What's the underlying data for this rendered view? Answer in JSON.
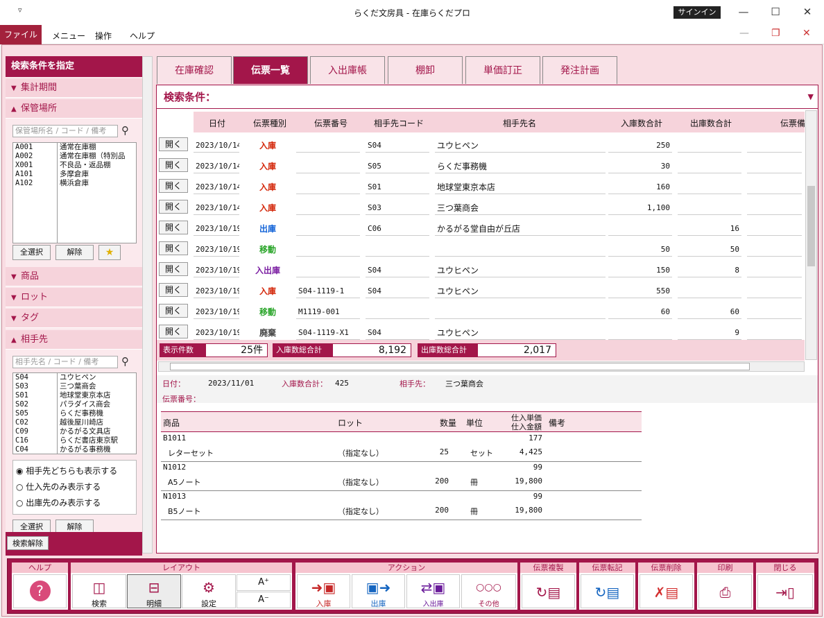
{
  "window": {
    "quick_access": "▿",
    "title": "らくだ文房具 - 在庫らくだプロ",
    "signin": "サインイン",
    "min": "—",
    "max": "☐",
    "close": "✕",
    "restore": "❐"
  },
  "menu": {
    "file": "ファイル",
    "menu": "メニュー",
    "ops": "操作",
    "help": "ヘルプ"
  },
  "left": {
    "header": "検索条件を指定",
    "sections": {
      "period": "集計期間",
      "location": "保管場所",
      "product": "商品",
      "lot": "ロット",
      "tag": "タグ",
      "partner": "相手先"
    },
    "loc_search_placeholder": "保管場所名 / コード / 備考",
    "locations": [
      {
        "code": "A001",
        "name": "通常在庫棚"
      },
      {
        "code": "A002",
        "name": "通常在庫棚（特別品"
      },
      {
        "code": "X001",
        "name": "不良品・返品棚"
      },
      {
        "code": "A101",
        "name": "多摩倉庫"
      },
      {
        "code": "A102",
        "name": "横浜倉庫"
      }
    ],
    "select_all": "全選択",
    "clear": "解除",
    "star": "★",
    "partner_search_placeholder": "相手先名 / コード / 備考",
    "partners": [
      {
        "code": "S04",
        "name": "ユウヒペン"
      },
      {
        "code": "S03",
        "name": "三つ葉商会"
      },
      {
        "code": "S01",
        "name": "地球堂東京本店"
      },
      {
        "code": "S02",
        "name": "パラダイス商会"
      },
      {
        "code": "S05",
        "name": "らくだ事務機"
      },
      {
        "code": "C02",
        "name": "越後屋川崎店"
      },
      {
        "code": "C09",
        "name": "かるがる文具店"
      },
      {
        "code": "C16",
        "name": "らくだ書店東京駅"
      },
      {
        "code": "C04",
        "name": "かるがる事務機"
      }
    ],
    "radio": [
      "相手先どちらも表示する",
      "仕入先のみ表示する",
      "出庫先のみ表示する"
    ],
    "select_all2": "全選択",
    "clear2": "解除",
    "search_clear": "検索解除"
  },
  "tabs": [
    "在庫確認",
    "伝票一覧",
    "入出庫帳",
    "棚卸",
    "単価訂正",
    "発注計画"
  ],
  "search_cond": "検索条件：",
  "grid": {
    "headers": {
      "date": "日付",
      "type": "伝票種別",
      "no": "伝票番号",
      "code": "相手先コード",
      "name": "相手先名",
      "in": "入庫数合計",
      "out": "出庫数合計",
      "note": "伝票備"
    },
    "open": "開く",
    "rows": [
      {
        "date": "2023/10/14",
        "type": "入庫",
        "no": "",
        "code": "S04",
        "name": "ユウヒペン",
        "in": "250",
        "out": ""
      },
      {
        "date": "2023/10/14",
        "type": "入庫",
        "no": "",
        "code": "S05",
        "name": "らくだ事務機",
        "in": "30",
        "out": ""
      },
      {
        "date": "2023/10/14",
        "type": "入庫",
        "no": "",
        "code": "S01",
        "name": "地球堂東京本店",
        "in": "160",
        "out": ""
      },
      {
        "date": "2023/10/14",
        "type": "入庫",
        "no": "",
        "code": "S03",
        "name": "三つ葉商会",
        "in": "1,100",
        "out": ""
      },
      {
        "date": "2023/10/19",
        "type": "出庫",
        "no": "",
        "code": "C06",
        "name": "かるがる堂自由が丘店",
        "in": "",
        "out": "16"
      },
      {
        "date": "2023/10/19",
        "type": "移動",
        "no": "",
        "code": "",
        "name": "",
        "in": "50",
        "out": "50"
      },
      {
        "date": "2023/10/19",
        "type": "入出庫",
        "no": "",
        "code": "S04",
        "name": "ユウヒペン",
        "in": "150",
        "out": "8"
      },
      {
        "date": "2023/10/19",
        "type": "入庫",
        "no": "S04-1119-1",
        "code": "S04",
        "name": "ユウヒペン",
        "in": "550",
        "out": ""
      },
      {
        "date": "2023/10/19",
        "type": "移動",
        "no": "M1119-001",
        "code": "",
        "name": "",
        "in": "60",
        "out": "60"
      },
      {
        "date": "2023/10/19",
        "type": "廃棄",
        "no": "S04-1119-X1",
        "code": "S04",
        "name": "ユウヒペン",
        "in": "",
        "out": "9"
      }
    ],
    "type_colors": {
      "入庫": "#d4290c",
      "出庫": "#1565d8",
      "移動": "#2aa52a",
      "入出庫": "#7b1fa2",
      "廃棄": "#444444"
    }
  },
  "totals": {
    "count_label": "表示件数",
    "count": "25件",
    "in_label": "入庫数総合計",
    "in": "8,192",
    "out_label": "出庫数総合計",
    "out": "2,017"
  },
  "detail": {
    "date_label": "日付：",
    "date": "2023/11/01",
    "in_label": "入庫数合計：",
    "in": "425",
    "partner_label": "相手先：",
    "partner": "三つ葉商会",
    "no_label": "伝票番号："
  },
  "dtable": {
    "h_product": "商品",
    "h_lot": "ロット",
    "h_qty": "数量",
    "h_unit": "単位",
    "h_price": "仕入単価",
    "h_amount": "仕入金額",
    "h_note": "備考",
    "rows": [
      {
        "code": "B1011",
        "name": "レターセット",
        "lot": "（指定なし）",
        "qty": "25",
        "unit": "セット",
        "price": "177",
        "amount": "4,425"
      },
      {
        "code": "N1012",
        "name": "A5ノート",
        "lot": "（指定なし）",
        "qty": "200",
        "unit": "冊",
        "price": "99",
        "amount": "19,800"
      },
      {
        "code": "N1013",
        "name": "B5ノート",
        "lot": "（指定なし）",
        "qty": "200",
        "unit": "冊",
        "price": "99",
        "amount": "19,800"
      }
    ]
  },
  "toolbar": {
    "help": "ヘルプ",
    "layout": "レイアウト",
    "action": "アクション",
    "copy": "伝票複製",
    "transfer": "伝票転記",
    "delete": "伝票削除",
    "print": "印刷",
    "close": "閉じる",
    "search": "検索",
    "detail": "明細",
    "settings": "設定",
    "font_up": "A⁺",
    "font_down": "A⁻",
    "in": "入庫",
    "out": "出庫",
    "inout": "入出庫",
    "other": "その他"
  }
}
